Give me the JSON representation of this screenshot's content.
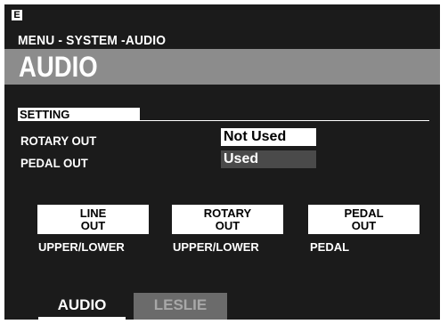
{
  "badge": "E",
  "breadcrumb": "MENU - SYSTEM -AUDIO",
  "title": "AUDIO",
  "setting": {
    "section_label": "SETTING",
    "rows": [
      {
        "label": "ROTARY OUT",
        "value": "Not Used",
        "state": "selected"
      },
      {
        "label": "PEDAL OUT",
        "value": "Used",
        "state": "normal"
      }
    ]
  },
  "outputs": [
    {
      "line1": "LINE",
      "line2": "OUT",
      "sub": "UPPER/LOWER"
    },
    {
      "line1": "ROTARY",
      "line2": "OUT",
      "sub": "UPPER/LOWER"
    },
    {
      "line1": "PEDAL",
      "line2": "OUT",
      "sub": "PEDAL"
    }
  ],
  "tabs": [
    {
      "label": "AUDIO",
      "active": true
    },
    {
      "label": "LESLIE",
      "active": false
    }
  ],
  "colors": {
    "screen_bg": "#1b1b1b",
    "title_band": "#8c8c8c",
    "text": "#ffffff",
    "inactive_tab_bg": "#6b6b6b"
  }
}
